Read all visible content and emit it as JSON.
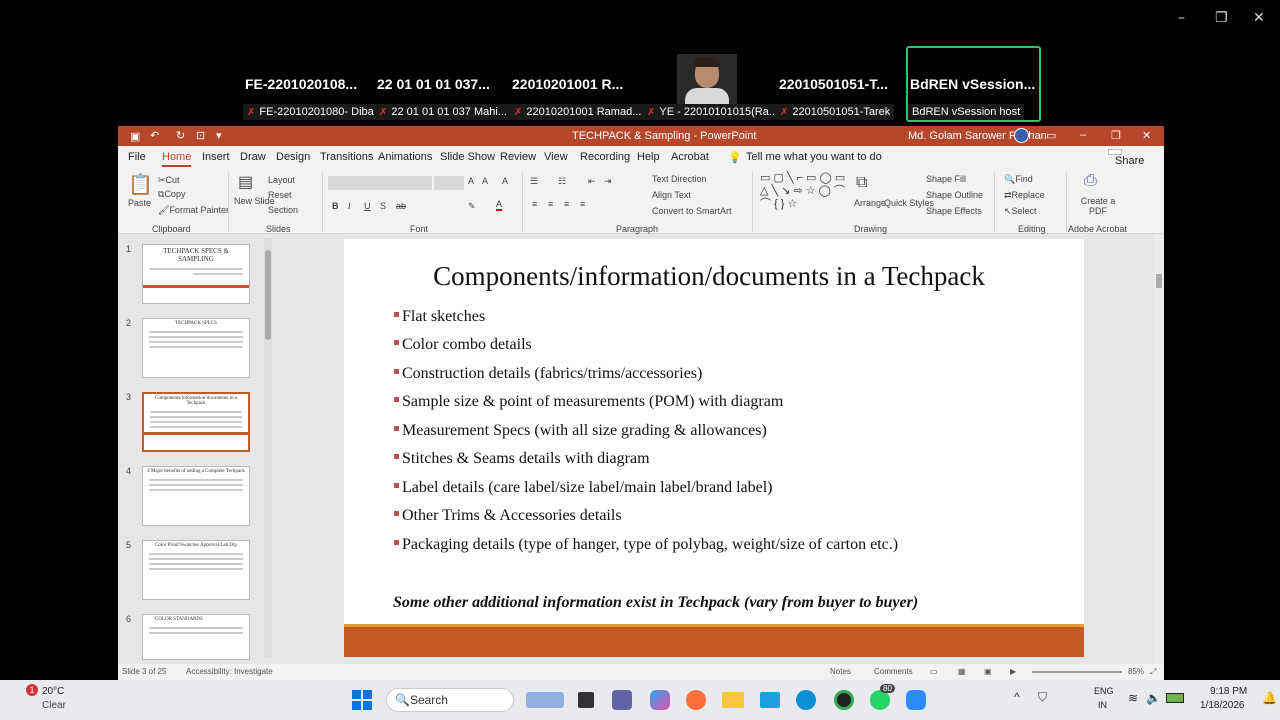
{
  "zoom": {
    "window_controls": [
      "–",
      "❐",
      "✕"
    ],
    "tiles": [
      {
        "name": "FE-2201020108...",
        "label": "FE-22010201080- Diba"
      },
      {
        "name": "22 01 01 01 037...",
        "label": "22 01 01 01 037 Mahi..."
      },
      {
        "name": "22010201001  R...",
        "label": "22010201001 Ramad..."
      },
      {
        "name": "",
        "label": "YE - 22010101015(Ra..."
      },
      {
        "name": "22010501051-T...",
        "label": "22010501051-Tarek"
      },
      {
        "name": "BdREN  vSession...",
        "label": "BdREN vSession host"
      }
    ],
    "active_color": "#2ec36c"
  },
  "ppt": {
    "title": "TECHPACK & Sampling  -  PowerPoint",
    "user": "Md. Golam Sarower Rayhan",
    "menu": [
      "File",
      "Home",
      "Insert",
      "Draw",
      "Design",
      "Transitions",
      "Animations",
      "Slide Show",
      "Review",
      "View",
      "Recording",
      "Help",
      "Acrobat"
    ],
    "tell_me": "Tell me what you want to do",
    "share": "Share",
    "ribbon": {
      "paste": "Paste",
      "cut": "Cut",
      "copy": "Copy",
      "format_painter": "Format Painter",
      "new_slide": "New Slide",
      "layout": "Layout",
      "reset": "Reset",
      "section": "Section",
      "text_direction": "Text Direction",
      "align_text": "Align Text",
      "convert_smartart": "Convert to SmartArt",
      "arrange": "Arrange",
      "quick_styles": "Quick Styles",
      "shape_fill": "Shape Fill",
      "shape_outline": "Shape Outline",
      "shape_effects": "Shape Effects",
      "find": "Find",
      "replace": "Replace",
      "select": "Select",
      "create_pdf": "Create a PDF",
      "groups": [
        "Clipboard",
        "Slides",
        "Font",
        "Paragraph",
        "Drawing",
        "Editing",
        "Adobe Acrobat"
      ]
    },
    "thumbs": [
      {
        "n": "1",
        "title": "TECHPACK SPECS & SAMPLING"
      },
      {
        "n": "2",
        "title": "TECHPACK SPECS"
      },
      {
        "n": "3",
        "title": "Components/information/documents in a Techpack"
      },
      {
        "n": "4",
        "title": "4 Major benefits of adding a Complete Techpack"
      },
      {
        "n": "5",
        "title": "Color Proof/Swatches Approval/Lab Dip"
      },
      {
        "n": "6",
        "title": "COLOR STANDARDS"
      }
    ],
    "slide": {
      "title": "Components/information/documents in a Techpack",
      "bullets": [
        "Flat sketches",
        "Color combo details",
        "Construction details (fabrics/trims/accessories)",
        "Sample size & point of measurements (POM) with diagram",
        "Measurement Specs (with all size grading & allowances)",
        "Stitches & Seams details with diagram",
        "Label details (care label/size label/main label/brand label)",
        "Other Trims & Accessories details",
        "Packaging details (type of hanger, type of polybag, weight/size of carton etc.)"
      ],
      "footer": "Some other additional information exist in Techpack (vary from buyer to buyer)"
    },
    "status": {
      "slide": "Slide 3 of 25",
      "accessibility": "Accessibility: Investigate",
      "notes": "Notes",
      "comments": "Comments",
      "zoom": "85%"
    }
  },
  "taskbar": {
    "weather_temp": "20°C",
    "weather_desc": "Clear",
    "weather_badge": "1",
    "search": "Search",
    "lang1": "ENG",
    "lang2": "IN",
    "time": "9:18 PM",
    "date": "1/18/2026",
    "whatsapp_badge": "80"
  }
}
